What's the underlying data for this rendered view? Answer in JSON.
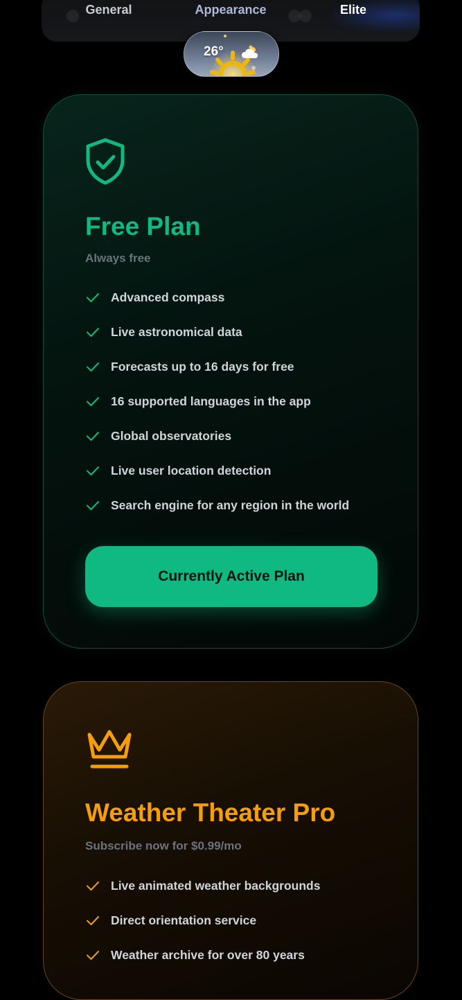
{
  "tabs": {
    "general": "General",
    "appearance": "Appearance",
    "elite": "Elite"
  },
  "weather": {
    "temperature": "26°",
    "condition_icon": "partly-cloudy-icon"
  },
  "colors": {
    "free_accent": "#10b981",
    "pro_accent": "#f59e0b",
    "background": "#000000",
    "muted_text": "#6b7280",
    "feature_text": "#d1d5db"
  },
  "free_plan": {
    "icon": "shield-check-icon",
    "title": "Free Plan",
    "subtitle": "Always free",
    "features": [
      "Advanced compass",
      "Live astronomical data",
      "Forecasts up to 16 days for free",
      "16 supported languages in the app",
      "Global observatories",
      "Live user location detection",
      "Search engine for any region in the world"
    ],
    "button_label": "Currently Active Plan"
  },
  "pro_plan": {
    "icon": "crown-icon",
    "title": "Weather Theater Pro",
    "subtitle": "Subscribe now for $0.99/mo",
    "features": [
      "Live animated weather backgrounds",
      "Direct orientation service",
      "Weather archive for over 80 years"
    ]
  }
}
